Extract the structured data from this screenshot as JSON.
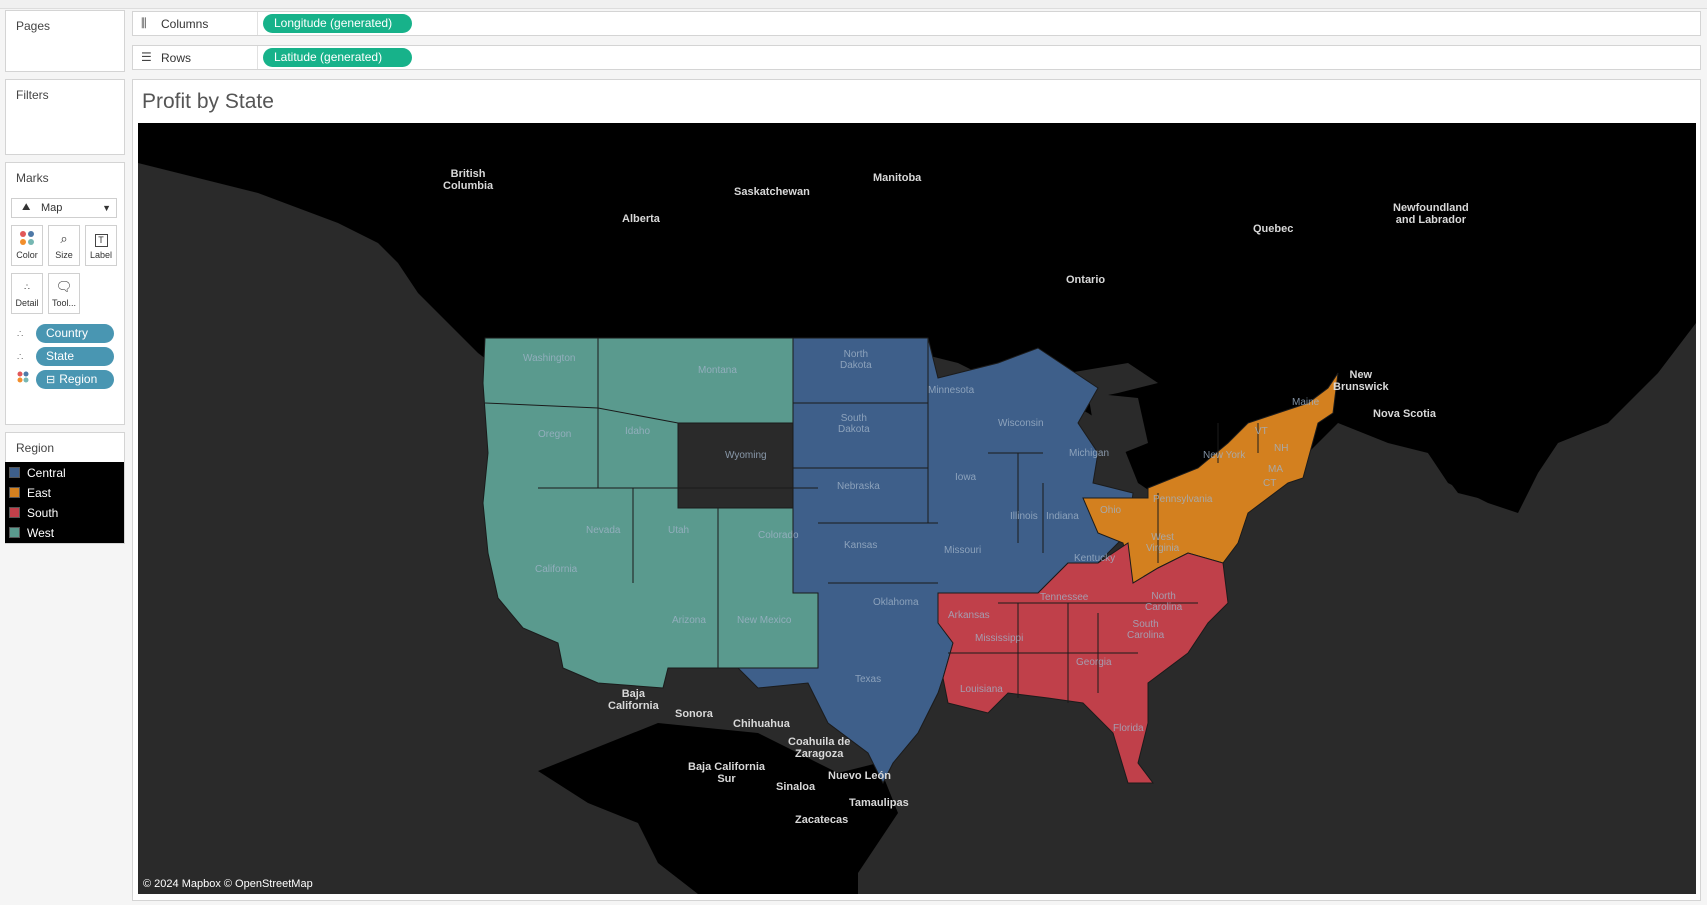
{
  "pages": {
    "title": "Pages"
  },
  "columns": {
    "label": "Columns",
    "pill": "Longitude (generated)"
  },
  "rows": {
    "label": "Rows",
    "pill": "Latitude (generated)"
  },
  "filters": {
    "title": "Filters"
  },
  "marks": {
    "title": "Marks",
    "type": "Map",
    "buttons": [
      "Color",
      "Size",
      "Label",
      "Detail",
      "Tool..."
    ],
    "pills": [
      "Country",
      "State",
      "Region"
    ]
  },
  "legend": {
    "title": "Region",
    "items": [
      {
        "label": "Central",
        "color": "#3e5f8a"
      },
      {
        "label": "East",
        "color": "#d3801f"
      },
      {
        "label": "South",
        "color": "#c0404a"
      },
      {
        "label": "West",
        "color": "#5a9a8e"
      }
    ]
  },
  "viz": {
    "title": "Profit by State",
    "attribution": "© 2024 Mapbox © OpenStreetMap",
    "place_labels": [
      "British\nColumbia",
      "Saskatchewan",
      "Manitoba",
      "Alberta",
      "Quebec",
      "Newfoundland\nand Labrador",
      "Ontario",
      "New\nBrunswick",
      "Nova Scotia",
      "Baja\nCalifornia",
      "Sonora",
      "Chihuahua",
      "Coahuila de\nZaragoza",
      "Baja California\nSur",
      "Sinaloa",
      "Nuevo León",
      "Tamaulipas",
      "Zacatecas"
    ],
    "state_labels": [
      "Washington",
      "Montana",
      "North\nDakota",
      "Minnesota",
      "Oregon",
      "Idaho",
      "South\nDakota",
      "Wisconsin",
      "Wyoming",
      "Michigan",
      "Maine",
      "New York",
      "Iowa",
      "Nebraska",
      "Pennsylvania",
      "Nevada",
      "Utah",
      "Colorado",
      "Illinois",
      "Indiana",
      "Ohio",
      "West\nVirginia",
      "Kansas",
      "Missouri",
      "Kentucky",
      "California",
      "Oklahoma",
      "Tennessee",
      "North\nCarolina",
      "Arizona",
      "New Mexico",
      "Arkansas",
      "Mississippi",
      "South\nCarolina",
      "Georgia",
      "Texas",
      "Louisiana",
      "Florida",
      "VT",
      "NH",
      "MA",
      "CT"
    ]
  }
}
